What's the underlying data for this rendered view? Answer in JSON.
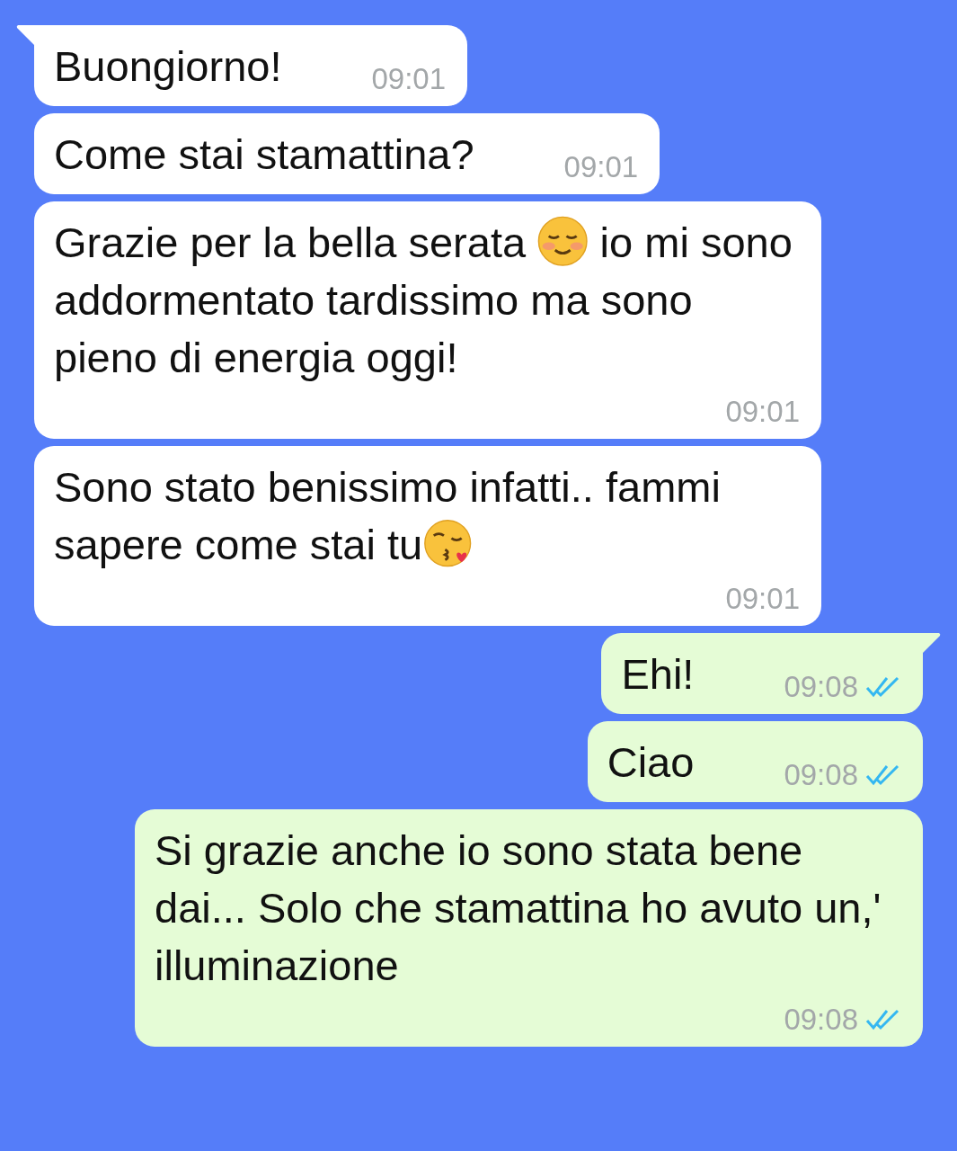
{
  "messages": [
    {
      "kind": "incoming",
      "tail": true,
      "parts": [
        {
          "kind": "text",
          "text": "Buongiorno!"
        }
      ],
      "time": "09:01"
    },
    {
      "kind": "incoming",
      "tail": false,
      "parts": [
        {
          "kind": "text",
          "text": "Come stai stamattina?"
        }
      ],
      "time": "09:01"
    },
    {
      "kind": "incoming",
      "tail": false,
      "parts": [
        {
          "kind": "text",
          "text": "Grazie per la bella serata "
        },
        {
          "kind": "blush"
        },
        {
          "kind": "text",
          "text": " io mi sono addormentato tardissimo ma sono pieno di energia oggi!"
        }
      ],
      "time": "09:01"
    },
    {
      "kind": "incoming",
      "tail": false,
      "parts": [
        {
          "kind": "text",
          "text": "Sono stato benissimo infatti.. fammi sapere come stai tu"
        },
        {
          "kind": "kiss"
        }
      ],
      "time": "09:01"
    },
    {
      "kind": "outgoing",
      "tail": true,
      "parts": [
        {
          "kind": "text",
          "text": "Ehi!"
        }
      ],
      "time": "09:08",
      "read": true
    },
    {
      "kind": "outgoing",
      "tail": false,
      "parts": [
        {
          "kind": "text",
          "text": "Ciao"
        }
      ],
      "time": "09:08",
      "read": true
    },
    {
      "kind": "outgoing",
      "tail": false,
      "parts": [
        {
          "kind": "text",
          "text": "Si grazie anche io sono stata bene dai... Solo che stamattina ho avuto un,' illuminazione"
        }
      ],
      "time": "09:08",
      "read": true
    }
  ]
}
